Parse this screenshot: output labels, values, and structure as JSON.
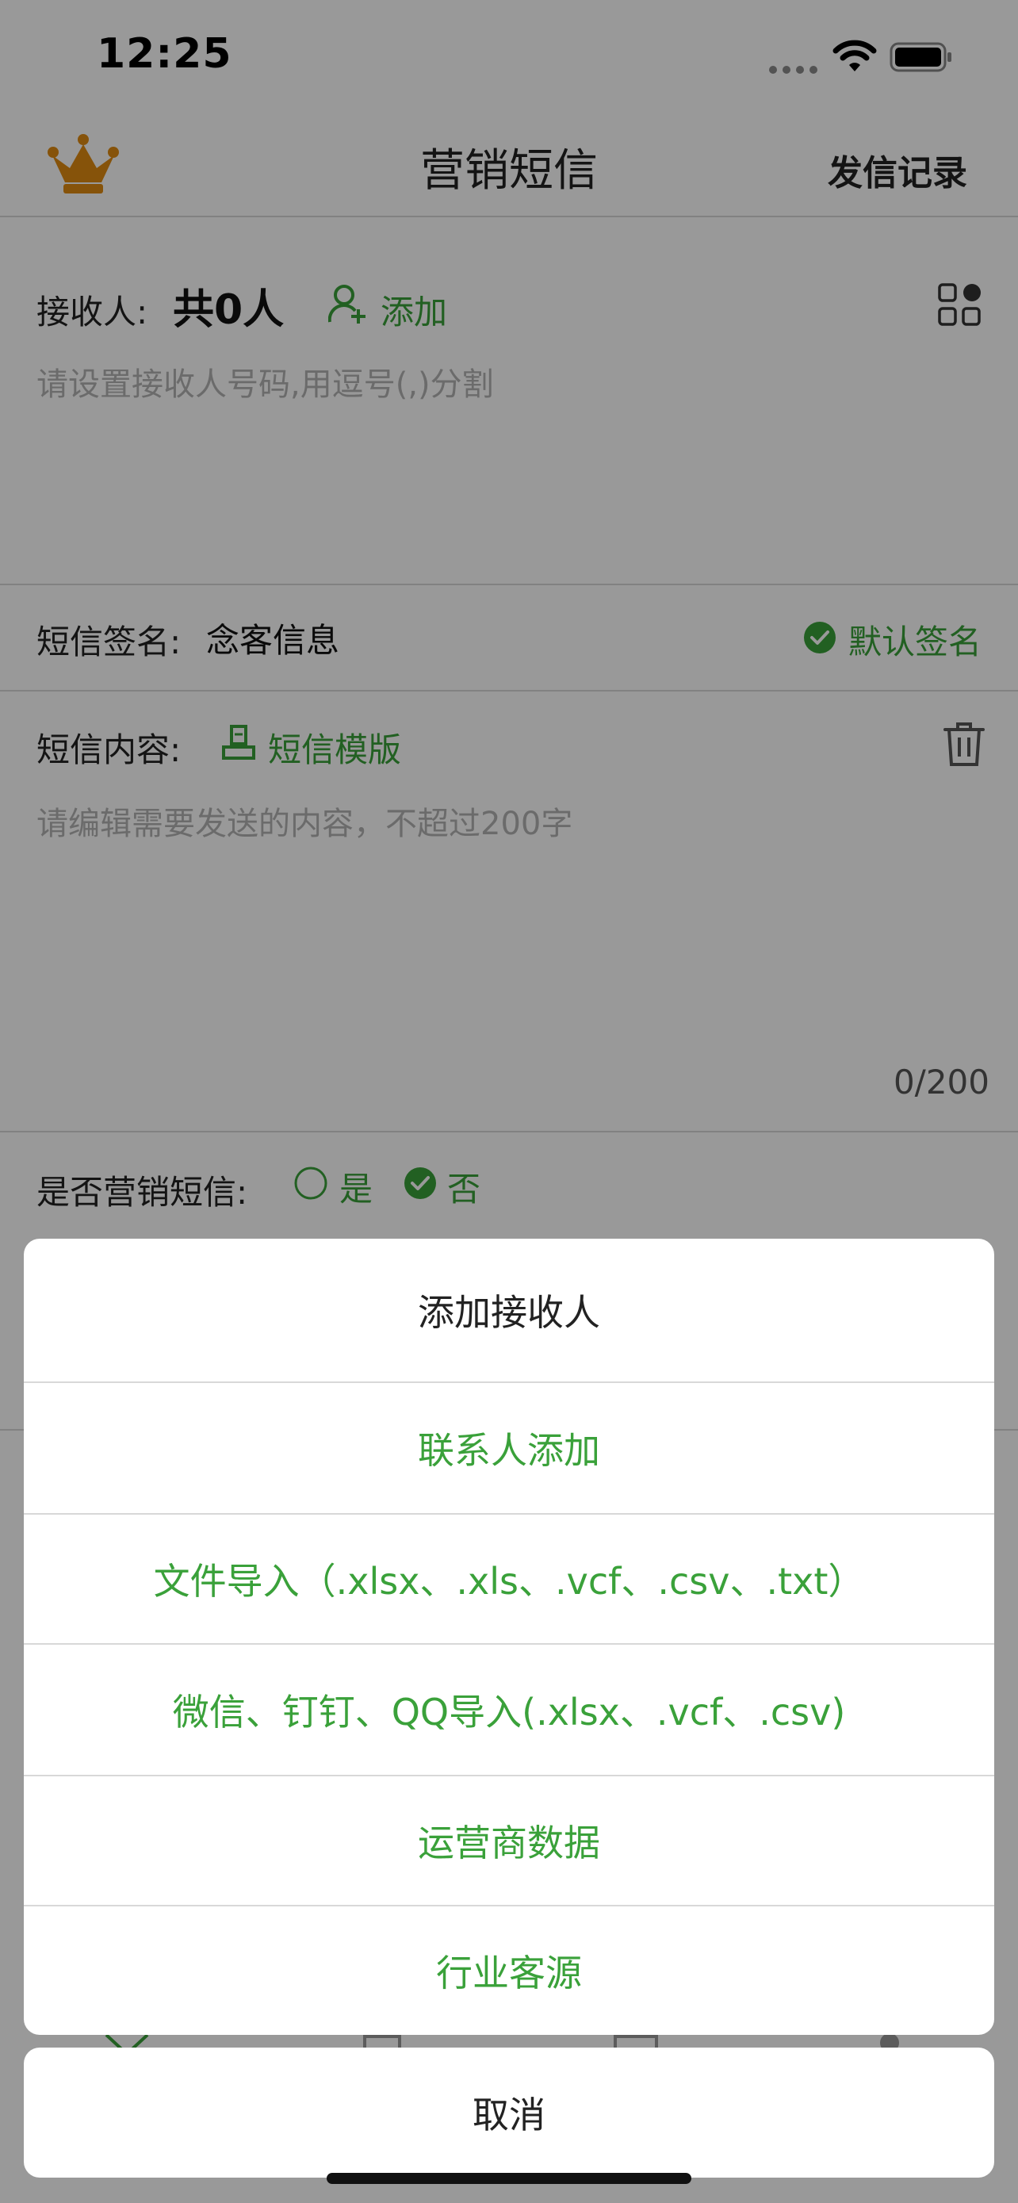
{
  "status_bar": {
    "time": "12:25"
  },
  "nav": {
    "title": "营销短信",
    "right_label": "发信记录"
  },
  "receiver": {
    "label": "接收人:",
    "count": "共0人",
    "add_label": "添加",
    "placeholder": "请设置接收人号码,用逗号(,)分割"
  },
  "signature": {
    "label": "短信签名:",
    "value": "念客信息",
    "default_label": "默认签名"
  },
  "content": {
    "label": "短信内容:",
    "template_label": "短信模版",
    "placeholder": "请编辑需要发送的内容，不超过200字",
    "counter": "0/200"
  },
  "marketing": {
    "label": "是否营销短信:",
    "yes": "是",
    "no": "否"
  },
  "sheet": {
    "title": "添加接收人",
    "options": [
      "联系人添加",
      "文件导入（.xlsx、.xls、.vcf、.csv、.txt）",
      "微信、钉钉、QQ导入(.xlsx、.vcf、.csv)",
      "运营商数据",
      "行业客源"
    ],
    "cancel": "取消"
  },
  "colors": {
    "accent_green": "#3aa13a",
    "crown_orange": "#e08a12"
  },
  "icons": [
    "crown-icon",
    "add-user-icon",
    "grid-icon",
    "check-circle-icon",
    "template-icon",
    "trash-icon",
    "radio-icon",
    "wifi-icon",
    "battery-icon"
  ]
}
